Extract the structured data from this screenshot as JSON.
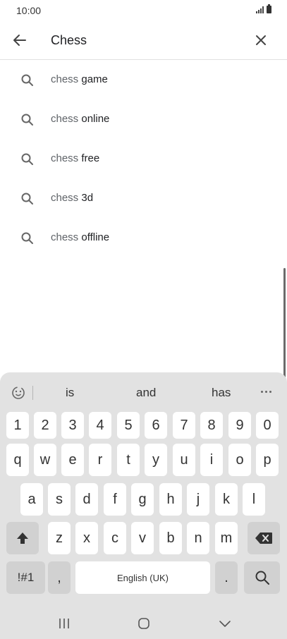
{
  "status_bar": {
    "time": "10:00"
  },
  "search": {
    "query": "Chess",
    "back_icon": "arrow-left-icon",
    "clear_icon": "close-icon"
  },
  "suggestions": [
    {
      "base": "chess",
      "rest": " game"
    },
    {
      "base": "chess",
      "rest": " online"
    },
    {
      "base": "chess",
      "rest": " free"
    },
    {
      "base": "chess",
      "rest": " 3d"
    },
    {
      "base": "chess",
      "rest": " offline"
    }
  ],
  "keyboard": {
    "predictions": [
      "is",
      "and",
      "has"
    ],
    "numbers": [
      "1",
      "2",
      "3",
      "4",
      "5",
      "6",
      "7",
      "8",
      "9",
      "0"
    ],
    "row1": [
      "q",
      "w",
      "e",
      "r",
      "t",
      "y",
      "u",
      "i",
      "o",
      "p"
    ],
    "row2": [
      "a",
      "s",
      "d",
      "f",
      "g",
      "h",
      "j",
      "k",
      "l"
    ],
    "row3": [
      "z",
      "x",
      "c",
      "v",
      "b",
      "n",
      "m"
    ],
    "symbols_label": "!#1",
    "comma_label": ",",
    "space_label": "English (UK)",
    "period_label": "."
  },
  "colors": {
    "keyboard_bg": "#e2e2e2",
    "key_bg": "#ffffff",
    "key_dark_bg": "#d1d1d1"
  }
}
